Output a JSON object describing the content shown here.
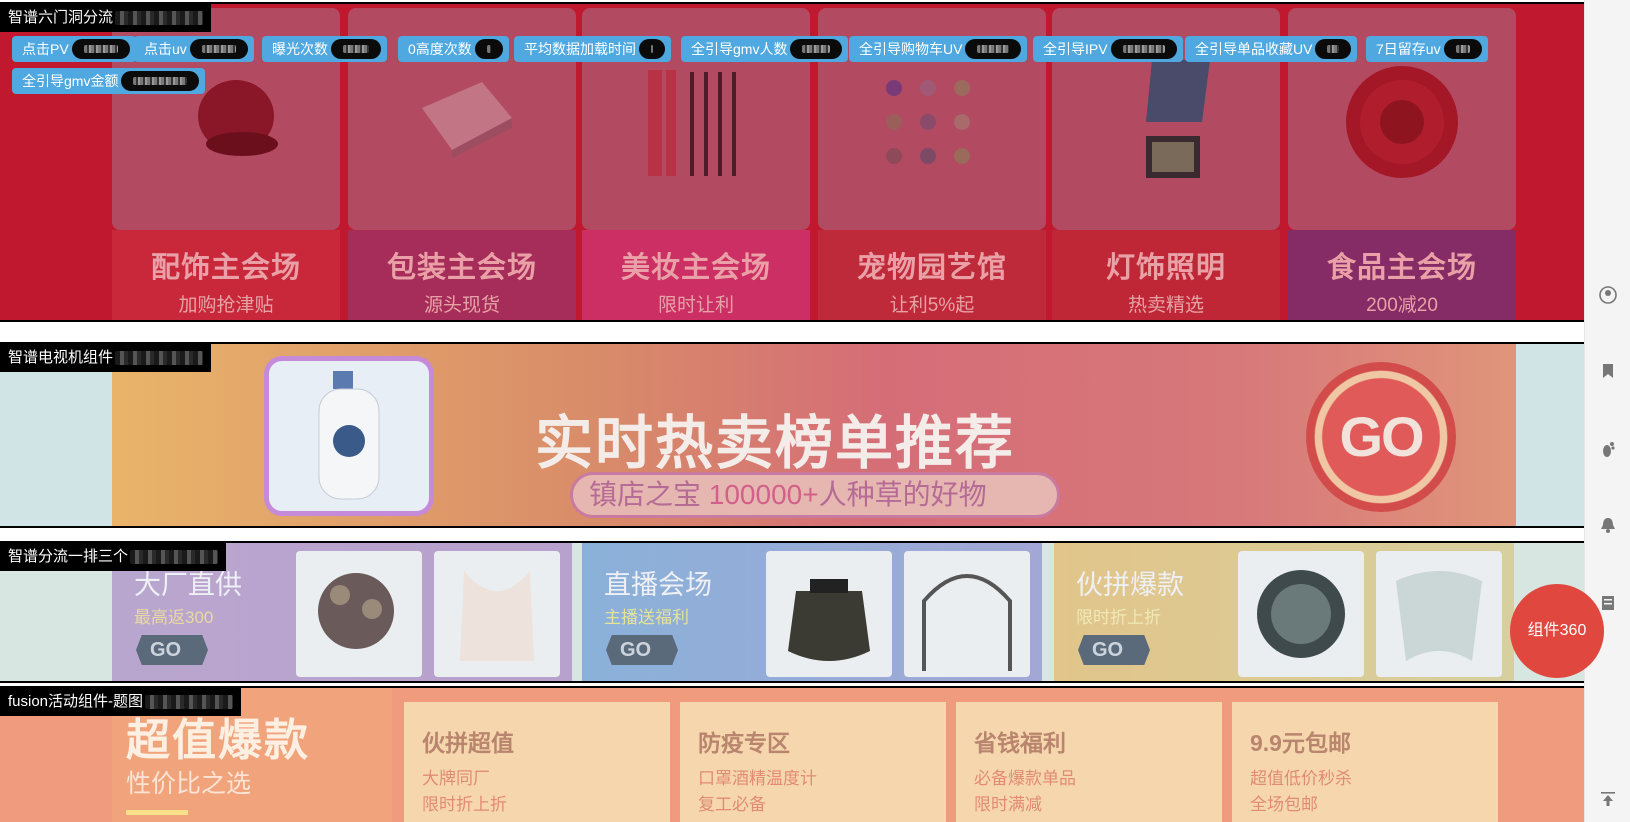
{
  "sections": {
    "hexagon": {
      "label": "智谱六门洞分流",
      "metrics": [
        {
          "label": "点击PV"
        },
        {
          "label": "点击uv"
        },
        {
          "label": "曝光次数"
        },
        {
          "label": "0高度次数"
        },
        {
          "label": "平均数据加载时间"
        },
        {
          "label": "全引导gmv人数"
        },
        {
          "label": "全引导购物车UV"
        },
        {
          "label": "全引导IPV"
        },
        {
          "label": "全引导单品收藏UV"
        },
        {
          "label": "7日留存uv"
        },
        {
          "label": "全引导gmv金额"
        }
      ],
      "cards": [
        {
          "title": "配饰主会场",
          "sub": "加购抢津贴"
        },
        {
          "title": "包装主会场",
          "sub": "源头现货"
        },
        {
          "title": "美妆主会场",
          "sub": "限时让利"
        },
        {
          "title": "宠物园艺馆",
          "sub": "让利5%起"
        },
        {
          "title": "灯饰照明",
          "sub": "热卖精选"
        },
        {
          "title": "食品主会场",
          "sub": "200减20"
        }
      ]
    },
    "tv": {
      "label": "智谱电视机组件",
      "title": "实时热卖榜单推荐",
      "sub_prefix": "镇店之宝 ",
      "sub_number": "100000+",
      "sub_suffix": "人种草的好物",
      "go": "GO"
    },
    "row3": {
      "label": "智谱分流一排三个",
      "panels": [
        {
          "title": "大厂直供",
          "sub": "最高返300",
          "go": "GO"
        },
        {
          "title": "直播会场",
          "sub": "主播送福利",
          "go": "GO"
        },
        {
          "title": "伙拼爆款",
          "sub": "限时折上折",
          "go": "GO"
        }
      ]
    },
    "fusion": {
      "label": "fusion活动组件-题图",
      "title": "超值爆款",
      "sub": "性价比之选",
      "cards": [
        {
          "title": "伙拼超值",
          "l1": "大牌同厂",
          "l2": "限时折上折"
        },
        {
          "title": "防疫专区",
          "l1": "口罩酒精温度计",
          "l2": "复工必备"
        },
        {
          "title": "省钱福利",
          "l1": "必备爆款单品",
          "l2": "限时满减"
        },
        {
          "title": "9.9元包邮",
          "l1": "超值低价秒杀",
          "l2": "全场包邮"
        }
      ]
    }
  },
  "fab": {
    "label": "组件360"
  },
  "rail_icons": [
    "user-icon",
    "bookmark-icon",
    "footprint-icon",
    "bell-icon",
    "document-icon",
    "back-to-top-icon"
  ],
  "colors": {
    "pill": "#4fa8e0",
    "section1_bg": "#c0192f",
    "fab": "#e0483f"
  }
}
